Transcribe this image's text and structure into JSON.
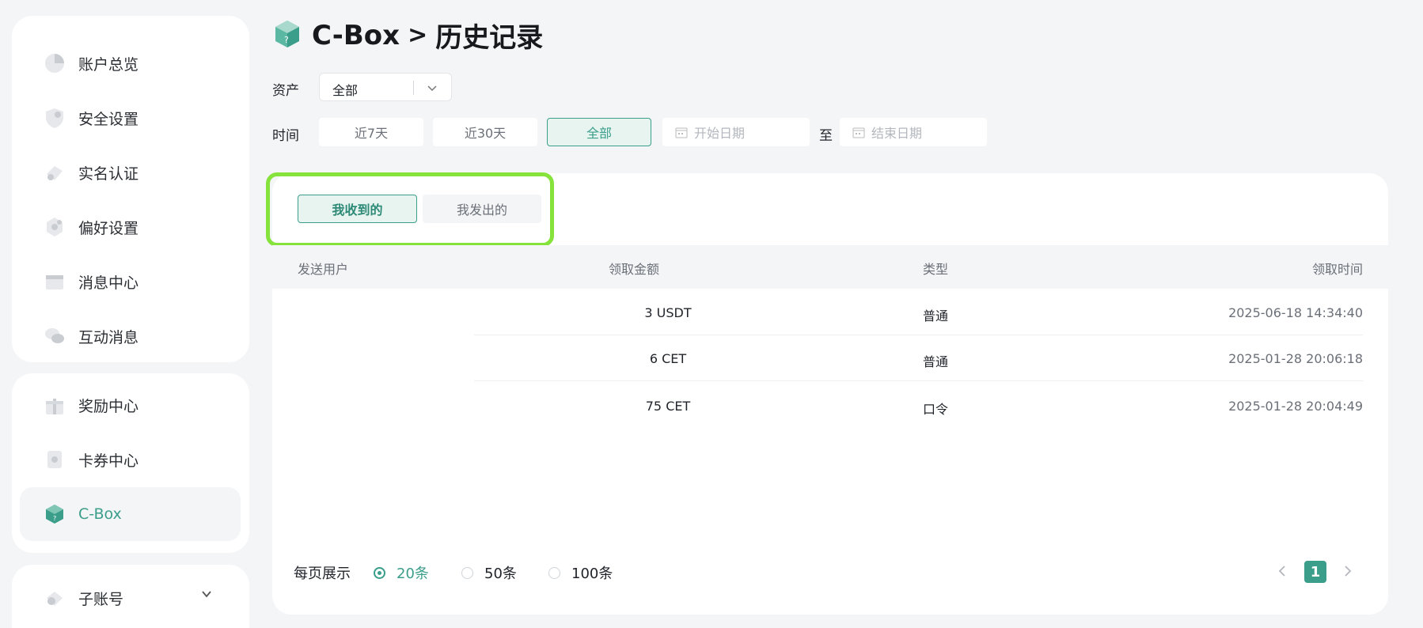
{
  "sidebar": {
    "group1": [
      {
        "label": "账户总览",
        "icon": "pie-chart-icon"
      },
      {
        "label": "安全设置",
        "icon": "shield-icon"
      },
      {
        "label": "实名认证",
        "icon": "id-badge-icon"
      },
      {
        "label": "偏好设置",
        "icon": "settings-gear-icon"
      },
      {
        "label": "消息中心",
        "icon": "inbox-icon"
      },
      {
        "label": "互动消息",
        "icon": "chat-bubbles-icon"
      }
    ],
    "group2": [
      {
        "label": "奖励中心",
        "icon": "gift-icon"
      },
      {
        "label": "卡券中心",
        "icon": "coupon-icon"
      },
      {
        "label": "C-Box",
        "icon": "cbox-cube-icon"
      }
    ],
    "group3": [
      {
        "label": "子账号",
        "icon": "sub-account-icon"
      }
    ]
  },
  "header": {
    "title_main": "C-Box",
    "separator": ">",
    "title_sub": "历史记录"
  },
  "filters": {
    "asset_label": "资产",
    "asset_value": "全部",
    "time_label": "时间",
    "time_options": [
      "近7天",
      "近30天",
      "全部"
    ],
    "time_selected": "全部",
    "start_placeholder": "开始日期",
    "to_label": "至",
    "end_placeholder": "结束日期"
  },
  "tabs": {
    "received": "我收到的",
    "sent": "我发出的"
  },
  "table": {
    "headers": [
      "发送用户",
      "领取金额",
      "类型",
      "领取时间"
    ],
    "rows": [
      {
        "user": "",
        "amount": "3 USDT",
        "type": "普通",
        "time": "2025-06-18 14:34:40"
      },
      {
        "user": "",
        "amount": "6 CET",
        "type": "普通",
        "time": "2025-01-28 20:06:18"
      },
      {
        "user": "",
        "amount": "75 CET",
        "type": "口令",
        "time": "2025-01-28 20:04:49"
      }
    ]
  },
  "pagination": {
    "per_page_label": "每页展示",
    "options": [
      "20条",
      "50条",
      "100条"
    ],
    "selected": "20条",
    "current_page": "1"
  },
  "colors": {
    "accent": "#3b9e8a",
    "highlight": "#86e33c"
  }
}
